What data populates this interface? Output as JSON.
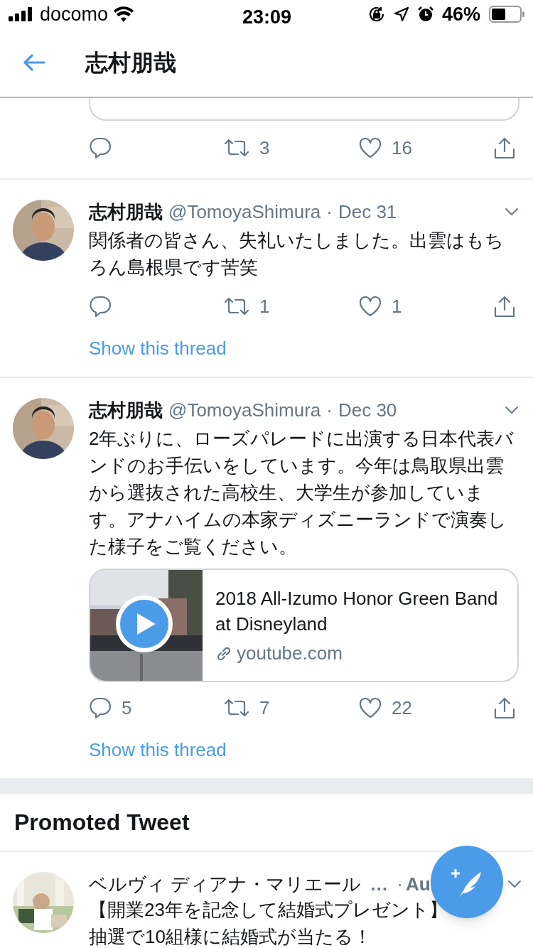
{
  "status_bar": {
    "carrier": "docomo",
    "time": "23:09",
    "battery": "46%"
  },
  "header": {
    "title": "志村朋哉"
  },
  "partial_tweet": {
    "actions": {
      "retweet": "3",
      "like": "16"
    }
  },
  "tweets": [
    {
      "name": "志村朋哉",
      "handle": "@TomoyaShimura",
      "separator": "·",
      "date": "Dec 31",
      "text": "関係者の皆さん、失礼いたしました。出雲はもちろん島根県です苦笑",
      "actions": {
        "retweet": "1",
        "like": "1"
      },
      "thread_link": "Show this thread"
    },
    {
      "name": "志村朋哉",
      "handle": "@TomoyaShimura",
      "separator": "·",
      "date": "Dec 30",
      "text": "2年ぶりに、ローズパレードに出演する日本代表バンドのお手伝いをしています。今年は鳥取県出雲から選抜された高校生、大学生が参加しています。アナハイムの本家ディズニーランドで演奏した様子をご覧ください。",
      "card": {
        "title": "2018 All-Izumo Honor Green Band at Disneyland",
        "domain": "youtube.com"
      },
      "actions": {
        "reply": "5",
        "retweet": "7",
        "like": "22"
      },
      "thread_link": "Show this thread"
    }
  ],
  "promoted": {
    "heading": "Promoted Tweet",
    "name": "ベルヴィ ディアナ・マリエール",
    "handle": "…",
    "separator": "·",
    "date": "Au",
    "lines": [
      "【開業23年を記念して結婚式プレゼント】",
      "抽選で10組様に結婚式が当たる！"
    ]
  }
}
